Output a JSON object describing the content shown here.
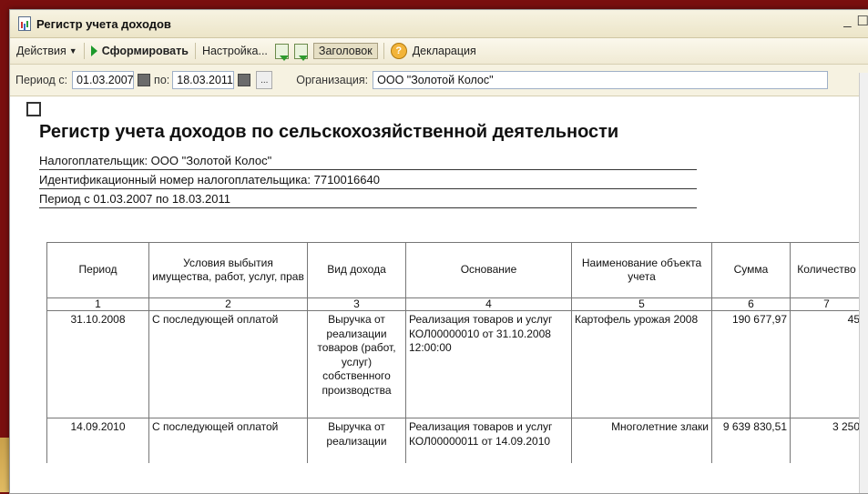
{
  "window": {
    "title": "Регистр учета доходов",
    "minimize": "_",
    "maximize": "☐"
  },
  "toolbar": {
    "actions": "Действия",
    "generate": "Сформировать",
    "settings": "Настройка...",
    "header": "Заголовок",
    "declaration": "Декларация"
  },
  "filters": {
    "period_from_label": "Период с:",
    "period_from": "01.03.2007",
    "period_to_label": "по:",
    "period_to": "18.03.2011",
    "org_label": "Организация:",
    "org": "ООО \"Золотой Колос\""
  },
  "report": {
    "title": "Регистр учета доходов по сельскохозяйственной деятельности",
    "taxpayer": "Налогоплательщик: ООО \"Золотой Колос\"",
    "inn": "Идентификационный номер налогоплательщика: 7710016640",
    "period": "Период с 01.03.2007 по 18.03.2011",
    "columns": [
      "Период",
      "Условия выбытия имущества, работ, услуг, прав",
      "Вид дохода",
      "Основание",
      "Наименование объекта учета",
      "Сумма",
      "Количество"
    ],
    "numbers": [
      "1",
      "2",
      "3",
      "4",
      "5",
      "6",
      "7"
    ],
    "rows": [
      {
        "period": "31.10.2008",
        "conditions": "С последующей оплатой",
        "income_type": "Выручка от реализации товаров (работ, услуг) собственного производства",
        "basis": "Реализация товаров и услуг КОЛ00000010 от 31.10.2008 12:00:00",
        "object": "Картофель урожая 2008",
        "sum": "190 677,97",
        "qty": "45"
      },
      {
        "period": "14.09.2010",
        "conditions": "С последующей оплатой",
        "income_type": "Выручка от реализации",
        "basis": "Реализация товаров и услуг КОЛ00000011 от 14.09.2010",
        "object": "Многолетние злаки",
        "sum": "9 639 830,51",
        "qty": "3 250"
      }
    ]
  }
}
